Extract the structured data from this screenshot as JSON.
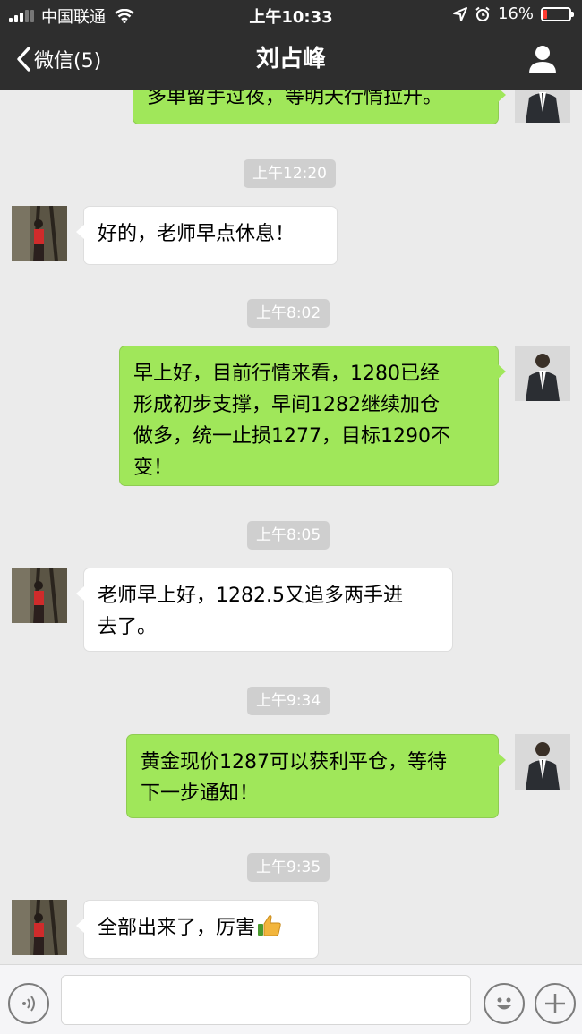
{
  "status_bar": {
    "carrier": "中国联通",
    "time": "上午10:33",
    "battery_text": "16%",
    "battery_level": 0.16,
    "signal_bars": 3,
    "signal_bars_total": 5,
    "icons": [
      "wifi-icon",
      "location-arrow-icon",
      "alarm-clock-icon",
      "battery-icon"
    ]
  },
  "nav": {
    "back_label": "微信(5)",
    "title": "刘占峰",
    "profile_icon": "person-icon"
  },
  "messages": {
    "m0": {
      "text": "多单留手过夜，等明天行情拉升。"
    },
    "t1": "上午12:20",
    "m1": {
      "text": "好的，老师早点休息！"
    },
    "t2": "上午8:02",
    "m2": {
      "line1": "早上好，目前行情来看，1280已经",
      "line2": "形成初步支撑，早间1282继续加仓",
      "line3": "做多，统一止损1277，目标1290不",
      "line4": "变！"
    },
    "t3": "上午8:05",
    "m3": {
      "line1": "老师早上好，1282.5又追多两手进",
      "line2": "去了。"
    },
    "t4": "上午9:34",
    "m4": {
      "line1": "黄金现价1287可以获利平仓，等待",
      "line2": "下一步通知！"
    },
    "t5": "上午9:35",
    "m5": {
      "text": "全部出来了，厉害",
      "emoji": "thumbs-up-icon"
    }
  },
  "input_bar": {
    "voice_icon": "voice-icon",
    "emoji_icon": "emoji-icon",
    "plus_icon": "plus-icon",
    "text_value": ""
  },
  "colors": {
    "bar_bg": "#2e2e2e",
    "chat_bg": "#ebebeb",
    "my_bubble": "#a0e75a",
    "their_bubble": "#ffffff",
    "timestamp_bg": "#cfcfcf",
    "battery_low": "#ff3b30"
  }
}
